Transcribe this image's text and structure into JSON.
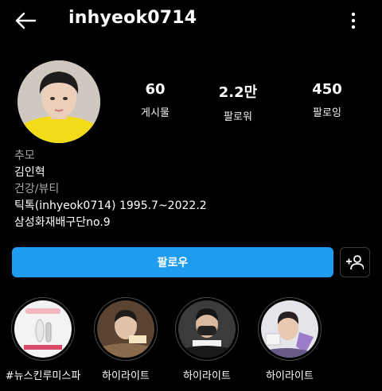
{
  "header": {
    "username": "inhyeok0714",
    "back_icon": "arrow-left-icon",
    "more_icon": "vertical-dots-icon"
  },
  "stats": [
    {
      "value": "60",
      "label": "게시물"
    },
    {
      "value": "2.2만",
      "label": "팔로워"
    },
    {
      "value": "450",
      "label": "팔로잉"
    }
  ],
  "bio": {
    "tag": "추모",
    "name": "김인혁",
    "category": "건강/뷰티",
    "line1": "틱톡(inhyeok0714) 1995.7~2022.2",
    "line2": "삼성화재배구단no.9"
  },
  "actions": {
    "follow_label": "팔로우",
    "suggest_icon": "add-person-icon"
  },
  "highlights": [
    {
      "label": "#뉴스킨루미스파"
    },
    {
      "label": "하이라이트"
    },
    {
      "label": "하이라이트"
    },
    {
      "label": "하이라이트"
    }
  ],
  "colors": {
    "background": "#000000",
    "follow_button": "#1f9bf0",
    "muted_text": "#a8a8a8"
  }
}
